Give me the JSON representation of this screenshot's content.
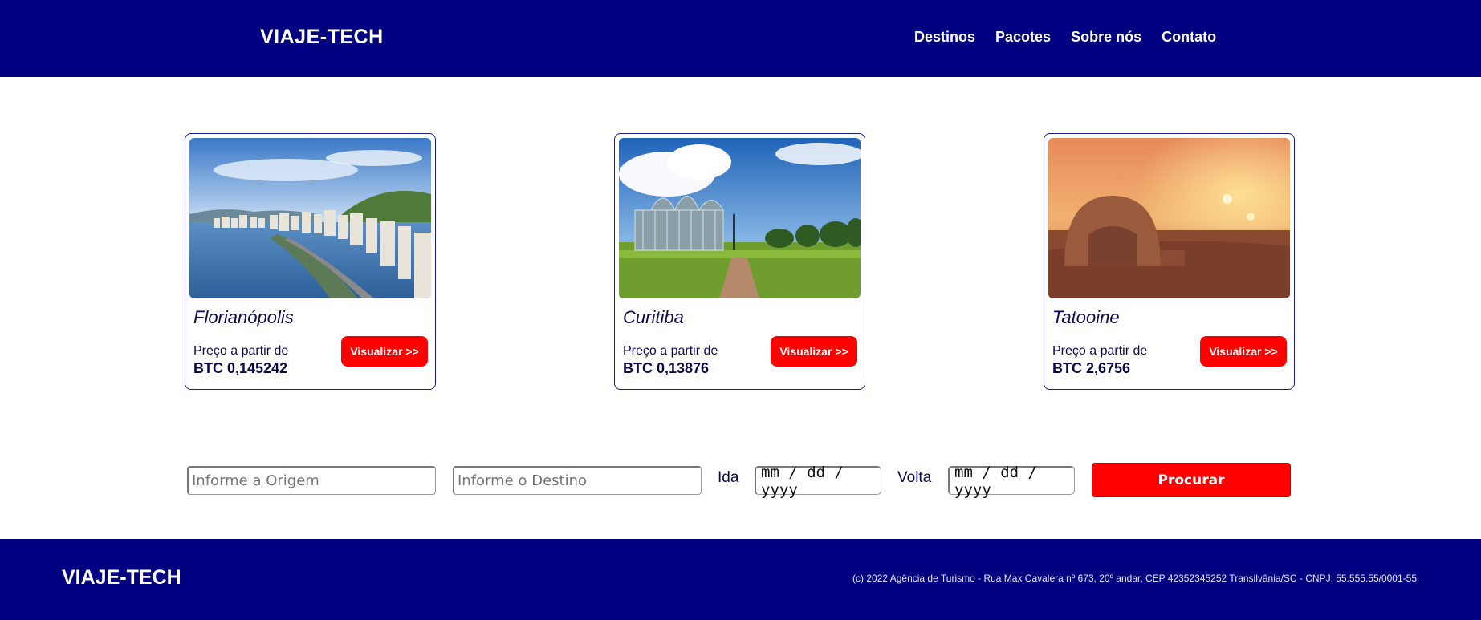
{
  "header": {
    "brand": "VIAJE-TECH",
    "nav": [
      "Destinos",
      "Pacotes",
      "Sobre nós",
      "Contato"
    ]
  },
  "cards": [
    {
      "city": "Florianópolis",
      "price_prefix": "Preço a partir de",
      "price": "BTC 0,145242",
      "button": "Visualizar >>"
    },
    {
      "city": "Curitiba",
      "price_prefix": "Preço a partir de",
      "price": "BTC 0,13876",
      "button": "Visualizar >>"
    },
    {
      "city": "Tatooine",
      "price_prefix": "Preço a partir de",
      "price": "BTC 2,6756",
      "button": "Visualizar >>"
    }
  ],
  "search": {
    "origin_placeholder": "Informe a Origem",
    "destination_placeholder": "Informe o Destino",
    "ida_label": "Ida",
    "ida_value": "mm / dd / yyyy",
    "volta_label": "Volta",
    "volta_value": "mm / dd / yyyy",
    "button": "Procurar"
  },
  "footer": {
    "brand": "VIAJE-TECH",
    "copyright": "(c) 2022 Agência de Turismo - Rua Max Cavalera nº 673, 20º andar, CEP 42352345252 Transilvânia/SC - CNPJ: 55.555.55/0001-55"
  },
  "colors": {
    "primary": "#010080",
    "accent": "#ff0000",
    "text": "#0a0a4a"
  }
}
